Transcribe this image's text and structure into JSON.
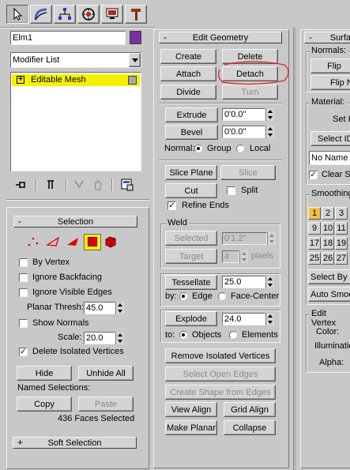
{
  "toolbar": {
    "tabs": [
      "create-tab",
      "modify-tab",
      "hierarchy-tab",
      "motion-tab",
      "display-tab",
      "utilities-tab"
    ]
  },
  "object": {
    "name": "Elm1",
    "color": "#7a2fa0"
  },
  "modifier_list": {
    "value": "Modifier List"
  },
  "stack": {
    "item": "Editable Mesh",
    "highlight": "#f5f000"
  },
  "selection": {
    "title": "Selection",
    "by_vertex": "By Vertex",
    "ignore_backfacing": "Ignore Backfacing",
    "ignore_visible_edges": "Ignore Visible Edges",
    "planar_thresh_label": "Planar Thresh:",
    "planar_thresh_value": "45.0",
    "show_normals": "Show Normals",
    "scale_label": "Scale:",
    "scale_value": "20.0",
    "delete_isolated": "Delete Isolated Vertices",
    "hide": "Hide",
    "unhide_all": "Unhide All",
    "named_selections": "Named Selections:",
    "copy": "Copy",
    "paste": "Paste",
    "status": "436 Faces Selected"
  },
  "soft_selection": {
    "title": "Soft Selection"
  },
  "edit_geometry": {
    "title": "Edit Geometry",
    "create": "Create",
    "delete": "Delete",
    "attach": "Attach",
    "detach": "Detach",
    "divide": "Divide",
    "turn": "Turn",
    "extrude": "Extrude",
    "extrude_value": "0'0.0\"",
    "bevel": "Bevel",
    "bevel_value": "0'0.0\"",
    "normal_label": "Normal:",
    "group": "Group",
    "local": "Local",
    "slice_plane": "Slice Plane",
    "slice": "Slice",
    "cut": "Cut",
    "split": "Split",
    "refine_ends": "Refine Ends",
    "weld_title": "Weld",
    "selected": "Selected",
    "selected_value": "0'1.2\"",
    "target": "Target",
    "target_value": "4",
    "pixels": "pixels",
    "tessellate": "Tessellate",
    "tessellate_value": "25.0",
    "by_label": "by:",
    "edge": "Edge",
    "face_center": "Face-Center",
    "explode": "Explode",
    "explode_value": "24.0",
    "to_label": "to:",
    "objects": "Objects",
    "elements": "Elements",
    "remove_isolated": "Remove Isolated Vertices",
    "select_open_edges": "Select Open Edges",
    "create_shape": "Create Shape from Edges",
    "view_align": "View Align",
    "grid_align": "Grid Align",
    "make_planar": "Make Planar",
    "collapse": "Collapse"
  },
  "surface": {
    "title": "Surfa",
    "normals": "Normals:",
    "flip": "Flip",
    "flip_n": "Flip N",
    "material": "Material:",
    "set_id": "Set I",
    "select_id": "Select ID",
    "no_name": "No Name -",
    "clear_s": "Clear S",
    "smoothing": "Smoothing",
    "groups": [
      "1",
      "2",
      "3",
      "9",
      "10",
      "11",
      "17",
      "18",
      "19",
      "25",
      "26",
      "27"
    ],
    "select_by": "Select By S",
    "auto_smooth": "Auto Smoo",
    "edit_vertex": "Edit Vertex",
    "color": "Color:",
    "illumination": "Illuminatio",
    "alpha": "Alpha:"
  },
  "annotation_color": "#e8202a"
}
